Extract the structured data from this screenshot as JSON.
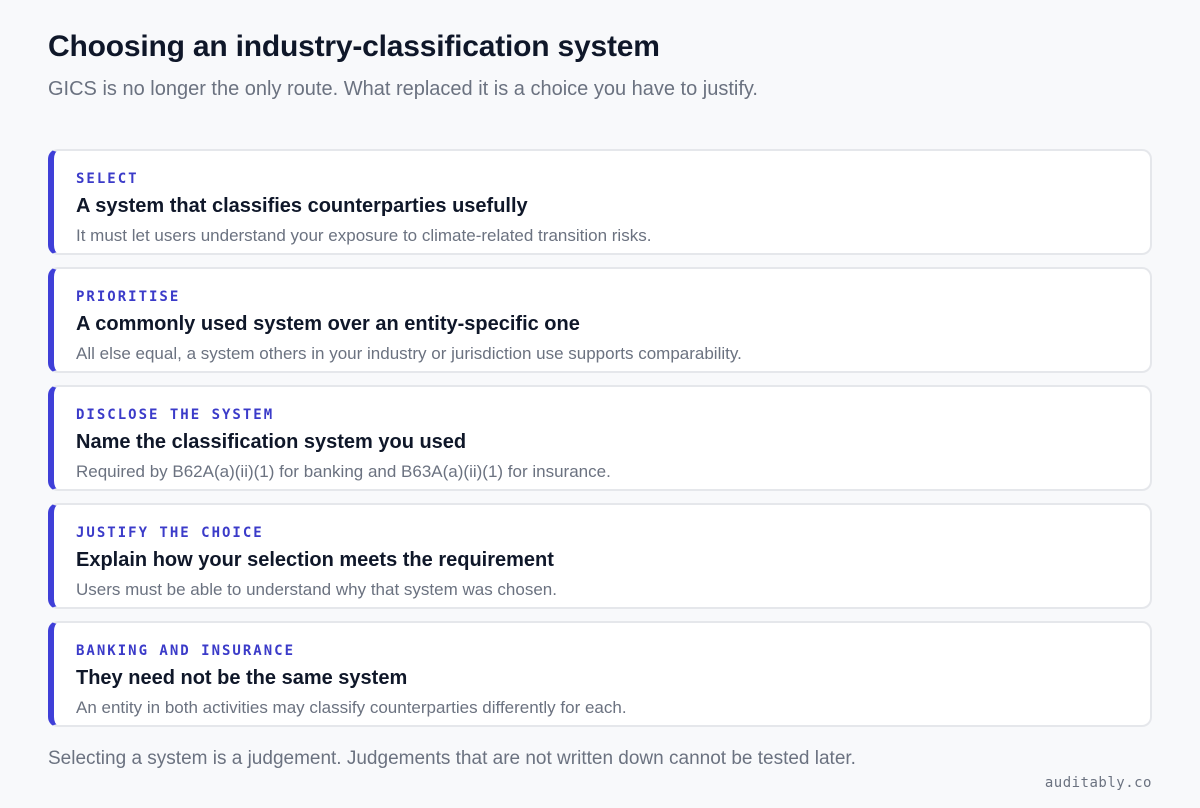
{
  "header": {
    "title": "Choosing an industry-classification system",
    "subtitle": "GICS is no longer the only route. What replaced it is a choice you have to justify."
  },
  "cards": [
    {
      "tag": "SELECT",
      "heading": "A system that classifies counterparties usefully",
      "body": "It must let users understand your exposure to climate-related transition risks."
    },
    {
      "tag": "PRIORITISE",
      "heading": "A commonly used system over an entity-specific one",
      "body": "All else equal, a system others in your industry or jurisdiction use supports comparability."
    },
    {
      "tag": "DISCLOSE THE SYSTEM",
      "heading": "Name the classification system you used",
      "body": "Required by B62A(a)(ii)(1) for banking and B63A(a)(ii)(1) for insurance."
    },
    {
      "tag": "JUSTIFY THE CHOICE",
      "heading": "Explain how your selection meets the requirement",
      "body": "Users must be able to understand why that system was chosen."
    },
    {
      "tag": "BANKING AND INSURANCE",
      "heading": "They need not be the same system",
      "body": "An entity in both activities may classify counterparties differently for each."
    }
  ],
  "footer": {
    "note": "Selecting a system is a judgement. Judgements that are not written down cannot be tested later.",
    "brand": "auditably.co"
  },
  "colors": {
    "accent": "#3f3fd8",
    "tag_text": "#3b3bc9",
    "background": "#f8f9fb",
    "card_border": "#e5e7eb"
  }
}
